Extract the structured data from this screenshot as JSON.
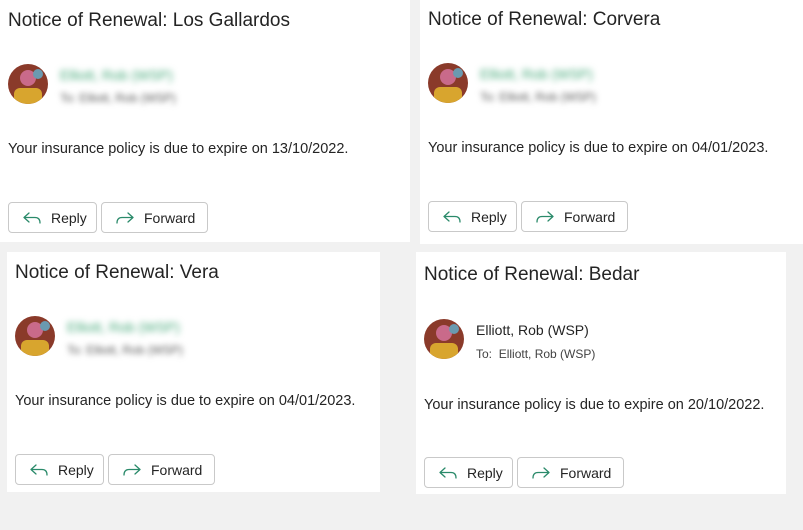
{
  "emails": [
    {
      "subject": "Notice of Renewal: Los Gallardos",
      "sender": "Elliott, Rob (WSP)",
      "to_label": "To:",
      "to": "Elliott, Rob (WSP)",
      "body": "Your insurance policy is due to expire on 13/10/2022.",
      "reply_label": "Reply",
      "forward_label": "Forward"
    },
    {
      "subject": "Notice of Renewal: Corvera",
      "sender": "Elliott, Rob (WSP)",
      "to_label": "To:",
      "to": "Elliott, Rob (WSP)",
      "body": "Your insurance policy is due to expire on 04/01/2023.",
      "reply_label": "Reply",
      "forward_label": "Forward"
    },
    {
      "subject": "Notice of Renewal: Vera",
      "sender": "Elliott, Rob (WSP)",
      "to_label": "To:",
      "to": "Elliott, Rob (WSP)",
      "body": "Your insurance policy is due to expire on 04/01/2023.",
      "reply_label": "Reply",
      "forward_label": "Forward"
    },
    {
      "subject": "Notice of Renewal: Bedar",
      "sender": "Elliott, Rob (WSP)",
      "to_label": "To:",
      "to": "Elliott, Rob (WSP)",
      "body": "Your insurance policy is due to expire on 20/10/2022.",
      "reply_label": "Reply",
      "forward_label": "Forward"
    }
  ],
  "icons": {
    "reply": "reply-arrow-icon",
    "forward": "forward-arrow-icon",
    "avatar": "user-avatar"
  },
  "colors": {
    "icon_accent": "#2a8a6a",
    "blurred_sender": "#3ea574",
    "card_border": "#c9c9c9"
  }
}
